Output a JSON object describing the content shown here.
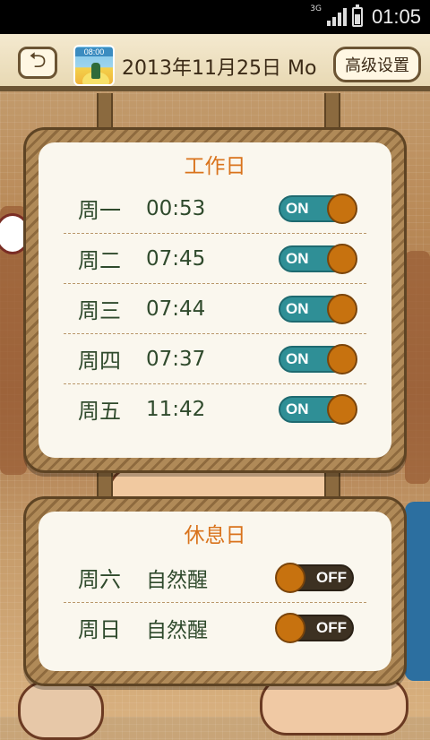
{
  "status_bar": {
    "network": "3G",
    "time": "01:05",
    "icons": [
      "signal-icon",
      "battery-icon"
    ]
  },
  "header": {
    "back_icon": "back-arrow-icon",
    "avatar_time": "08:00",
    "date": "2013年11月25日 Mo",
    "advanced_label": "高级设置"
  },
  "workdays": {
    "title": "工作日",
    "items": [
      {
        "day": "周一",
        "time": "00:53",
        "toggle": "ON"
      },
      {
        "day": "周二",
        "time": "07:45",
        "toggle": "ON"
      },
      {
        "day": "周三",
        "time": "07:44",
        "toggle": "ON"
      },
      {
        "day": "周四",
        "time": "07:37",
        "toggle": "ON"
      },
      {
        "day": "周五",
        "time": "11:42",
        "toggle": "ON"
      }
    ]
  },
  "weekend": {
    "title": "休息日",
    "items": [
      {
        "day": "周六",
        "time": "自然醒",
        "toggle": "OFF"
      },
      {
        "day": "周日",
        "time": "自然醒",
        "toggle": "OFF"
      }
    ]
  },
  "colors": {
    "title": "#d9731c",
    "text": "#2f4a2c",
    "toggle_on": "#2f8f96",
    "toggle_off": "#3d3122",
    "knob": "#c7720f"
  }
}
